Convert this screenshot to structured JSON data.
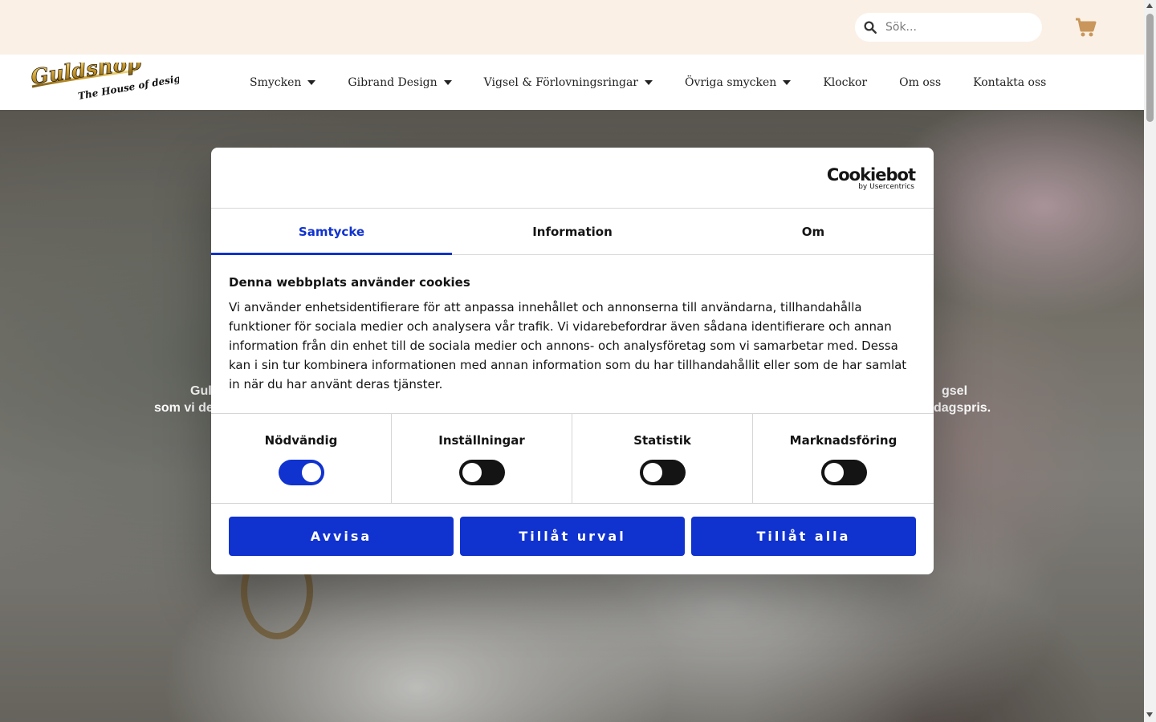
{
  "header": {
    "search_placeholder": "Sök...",
    "cart_icon": "cart-icon",
    "search_icon": "search-icon"
  },
  "nav": {
    "logo_text": "Guldshop",
    "logo_tagline": "The House of design",
    "items": [
      {
        "label": "Smycken",
        "dropdown": true
      },
      {
        "label": "Gibrand Design",
        "dropdown": true
      },
      {
        "label": "Vigsel & Förlovningsringar",
        "dropdown": true
      },
      {
        "label": "Övriga smycken",
        "dropdown": true
      },
      {
        "label": "Klockor",
        "dropdown": false
      },
      {
        "label": "Om oss",
        "dropdown": false
      },
      {
        "label": "Kontakta oss",
        "dropdown": false
      }
    ]
  },
  "hero": {
    "text_left_line1": "Gul",
    "text_left_line2": "som vi de",
    "text_right_line1": "gsel",
    "text_right_line2": "dagspris."
  },
  "cookie_dialog": {
    "brand": "Cookiebot",
    "brand_sub": "by Usercentrics",
    "tabs": [
      {
        "label": "Samtycke",
        "active": true
      },
      {
        "label": "Information",
        "active": false
      },
      {
        "label": "Om",
        "active": false
      }
    ],
    "title": "Denna webbplats använder cookies",
    "body": "Vi använder enhetsidentifierare för att anpassa innehållet och annonserna till användarna, tillhandahålla funktioner för sociala medier och analysera vår trafik. Vi vidarebefordrar även sådana identifierare och annan information från din enhet till de sociala medier och annons- och analysföretag som vi samarbetar med. Dessa kan i sin tur kombinera informationen med annan information som du har tillhandahållit eller som de har samlat in när du har använt deras tjänster.",
    "toggles": [
      {
        "label": "Nödvändig",
        "on": true
      },
      {
        "label": "Inställningar",
        "on": false
      },
      {
        "label": "Statistik",
        "on": false
      },
      {
        "label": "Marknadsföring",
        "on": false
      }
    ],
    "buttons": {
      "reject": "Avvisa",
      "allow_selection": "Tillåt urval",
      "allow_all": "Tillåt alla"
    },
    "accent_color": "#1032cf"
  },
  "colors": {
    "topbar_bg": "#faf0e6",
    "cart_color": "#c9975b"
  }
}
